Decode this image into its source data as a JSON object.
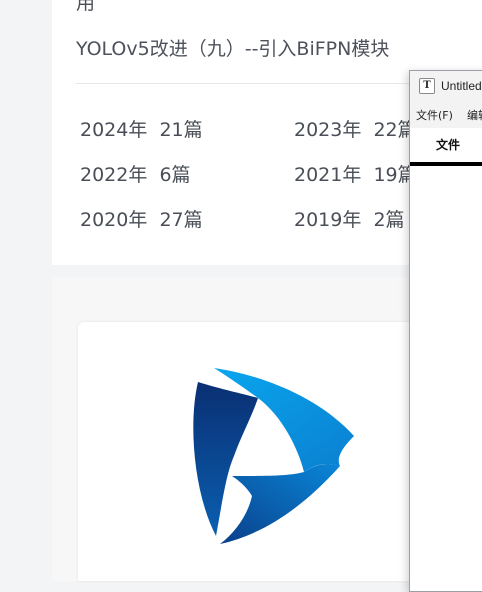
{
  "blog": {
    "cut_text": "用",
    "article_link": "YOLOv5改进（九）--引入BiFPN模块",
    "archive": [
      {
        "year": "2024年",
        "count": "21篇"
      },
      {
        "year": "2023年",
        "count": "22篇"
      },
      {
        "year": "2022年",
        "count": "6篇"
      },
      {
        "year": "2021年",
        "count": "19篇"
      },
      {
        "year": "2020年",
        "count": "27篇"
      },
      {
        "year": "2019年",
        "count": "2篇"
      }
    ]
  },
  "logo": {
    "icon": "triangle-play-logo-icon",
    "colors": {
      "dark": "#0a2f73",
      "mid": "#0a5fb0",
      "light": "#0aa0ea"
    }
  },
  "notepad": {
    "app_icon": "T",
    "title": "Untitled",
    "menu": [
      "文件(F)",
      "编辑"
    ],
    "tab": "文件"
  }
}
